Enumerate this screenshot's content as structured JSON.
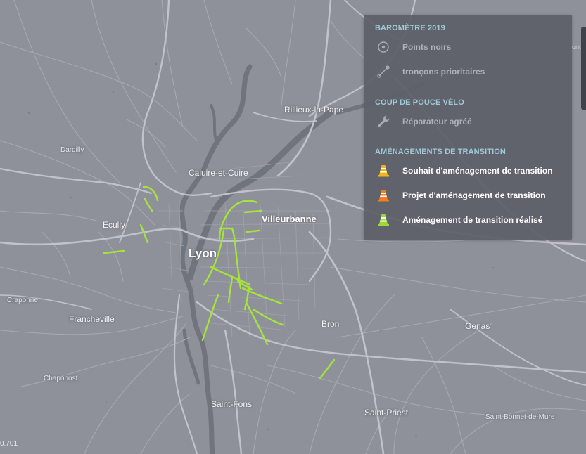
{
  "map": {
    "colors": {
      "background": "#8e9199",
      "road": "#a6a9b0",
      "major_road": "#bfc2c8",
      "river": "#70747c",
      "lane_realised": "#a6e33b"
    },
    "places": [
      {
        "name": "Rillieux-la-Pape",
        "class": "city-mid"
      },
      {
        "name": "Dardilly",
        "class": "small"
      },
      {
        "name": "Caluire-et-Cuire",
        "class": "city-mid"
      },
      {
        "name": "Écully",
        "class": "city-mid"
      },
      {
        "name": "Villeurbanne",
        "class": "city"
      },
      {
        "name": "Lyon",
        "class": "major"
      },
      {
        "name": "Craponne",
        "class": "small"
      },
      {
        "name": "Francheville",
        "class": "city-mid"
      },
      {
        "name": "Bron",
        "class": "city-mid"
      },
      {
        "name": "Genas",
        "class": "city-mid"
      },
      {
        "name": "Chaponost",
        "class": "small"
      },
      {
        "name": "Saint-Fons",
        "class": "city-mid"
      },
      {
        "name": "Saint-Priest",
        "class": "city-mid"
      },
      {
        "name": "Saint-Bonnet-de-Mure",
        "class": "small"
      }
    ],
    "edge_label": "onti",
    "scale_label": "0.701"
  },
  "legend": {
    "sections": [
      {
        "heading": "BAROMÈTRE 2019",
        "items": [
          {
            "label": "Points noirs",
            "icon": "target-dot-icon",
            "active": false
          },
          {
            "label": "tronçons prioritaires",
            "icon": "segment-icon",
            "active": false
          }
        ]
      },
      {
        "heading": "COUP DE POUCE VÉLO",
        "items": [
          {
            "label": "Réparateur agréé",
            "icon": "wrench-icon",
            "active": false
          }
        ]
      },
      {
        "heading": "AMÉNAGEMENTS DE TRANSITION",
        "items": [
          {
            "label": "Souhait d'aménagement de transition",
            "icon": "traffic-cone-yellow-icon",
            "color": "#f2b51b",
            "active": true
          },
          {
            "label": "Projet d'aménagement de transition",
            "icon": "traffic-cone-orange-icon",
            "color": "#ef7d22",
            "active": true
          },
          {
            "label": "Aménagement de transition réalisé",
            "icon": "traffic-cone-green-icon",
            "color": "#9fd63a",
            "active": true
          }
        ]
      }
    ]
  }
}
